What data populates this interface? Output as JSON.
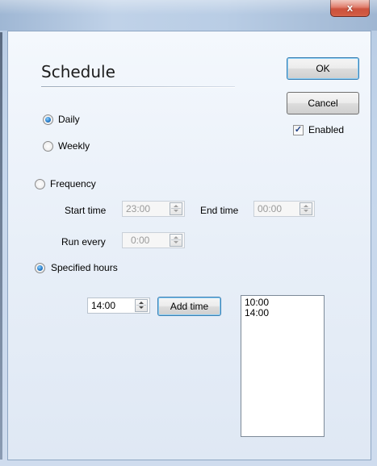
{
  "window": {
    "close_label": "x"
  },
  "heading": "Schedule",
  "buttons": {
    "ok": "OK",
    "cancel": "Cancel"
  },
  "enabled": {
    "label": "Enabled",
    "checked": true,
    "check_glyph": "✓"
  },
  "period": {
    "daily": {
      "label": "Daily",
      "selected": true
    },
    "weekly": {
      "label": "Weekly",
      "selected": false
    }
  },
  "mode": {
    "frequency": {
      "label": "Frequency",
      "selected": false
    },
    "specified": {
      "label": "Specified hours",
      "selected": true
    }
  },
  "frequency": {
    "start_label": "Start time",
    "start_value": "23:00",
    "end_label": "End time",
    "end_value": "00:00",
    "run_every_label": "Run every",
    "run_every_value": "0:00"
  },
  "specified": {
    "time_value": "14:00",
    "add_button": "Add time",
    "times": [
      "10:00",
      "14:00"
    ]
  }
}
